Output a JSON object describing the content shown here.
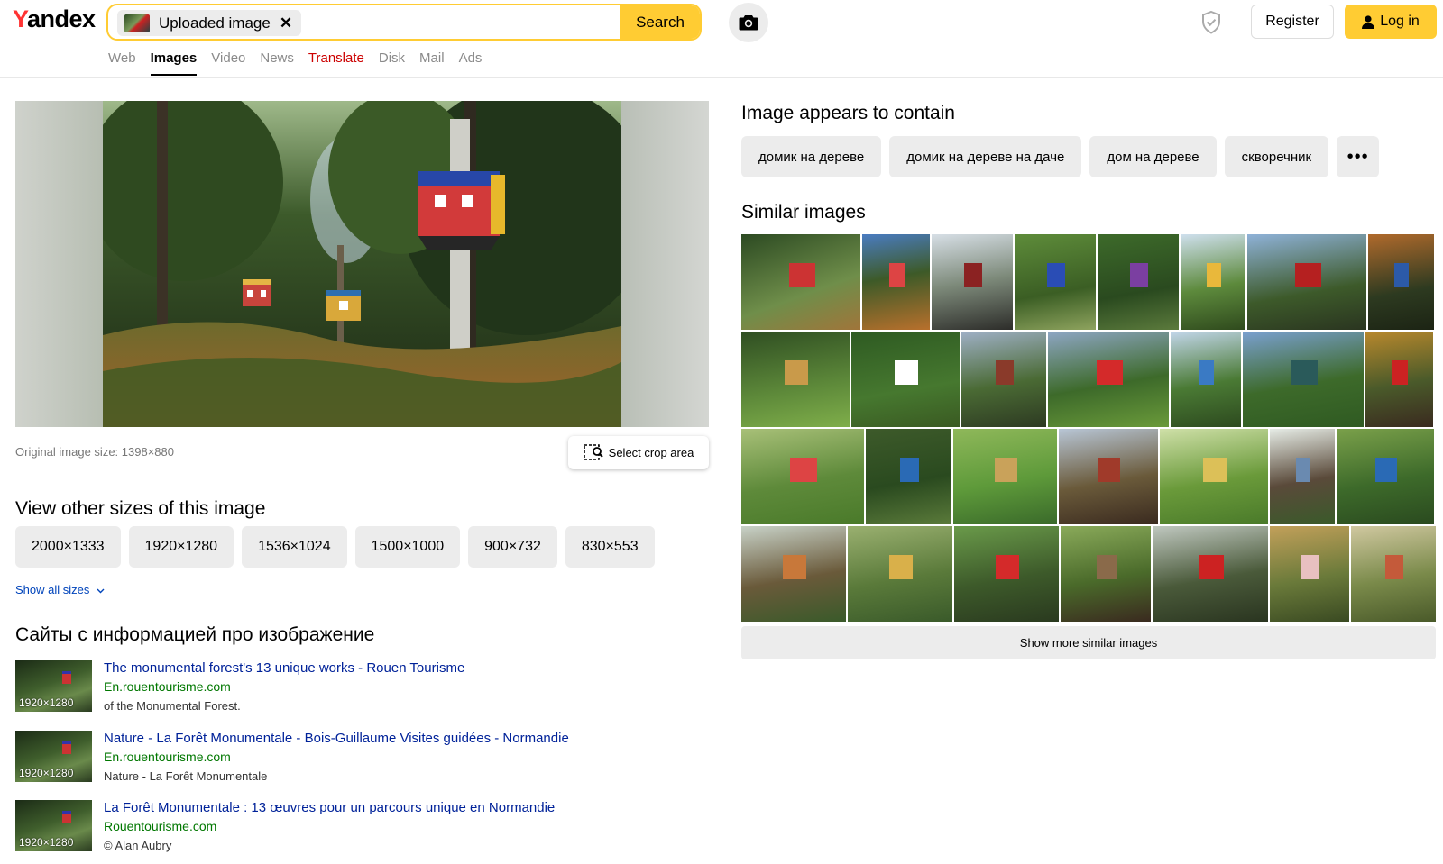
{
  "header": {
    "logo": "Yandex",
    "search_chip_label": "Uploaded image",
    "search_chip_close": "✕",
    "search_button": "Search",
    "register_button": "Register",
    "login_button": "Log in",
    "brand_color": "#ffcc33"
  },
  "nav": {
    "tabs": [
      {
        "label": "Web"
      },
      {
        "label": "Images"
      },
      {
        "label": "Video"
      },
      {
        "label": "News"
      },
      {
        "label": "Translate"
      },
      {
        "label": "Disk"
      },
      {
        "label": "Mail"
      },
      {
        "label": "Ads"
      }
    ],
    "active": "Images"
  },
  "viewer": {
    "original_size": "Original image size: 1398×880",
    "crop_button": "Select crop area"
  },
  "other_sizes": {
    "heading": "View other sizes of this image",
    "sizes": [
      "2000×1333",
      "1920×1280",
      "1536×1024",
      "1500×1000",
      "900×732",
      "830×553"
    ],
    "show_all": "Show all sizes"
  },
  "sites": {
    "heading": "Сайты с информацией про изображение",
    "items": [
      {
        "thumb_size": "1920×1280",
        "title": "The monumental forest's 13 unique works - Rouen Tourisme",
        "domain": "En.rouentourisme.com",
        "snippet": "of the Monumental Forest."
      },
      {
        "thumb_size": "1920×1280",
        "title": "Nature - La Forêt Monumentale - Bois-Guillaume Visites guidées - Normandie",
        "domain": "En.rouentourisme.com",
        "snippet": "Nature - La Forêt Monumentale"
      },
      {
        "thumb_size": "1920×1280",
        "title": "La Forêt Monumentale : 13 œuvres pour un parcours unique en Normandie",
        "domain": "Rouentourisme.com",
        "snippet": "© Alan Aubry"
      }
    ]
  },
  "contains": {
    "heading": "Image appears to contain",
    "tags": [
      "домик на дереве",
      "домик на дереве на даче",
      "дом на дереве",
      "скворечник"
    ],
    "more": "•••"
  },
  "similar": {
    "heading": "Similar images",
    "show_more": "Show more similar images"
  }
}
